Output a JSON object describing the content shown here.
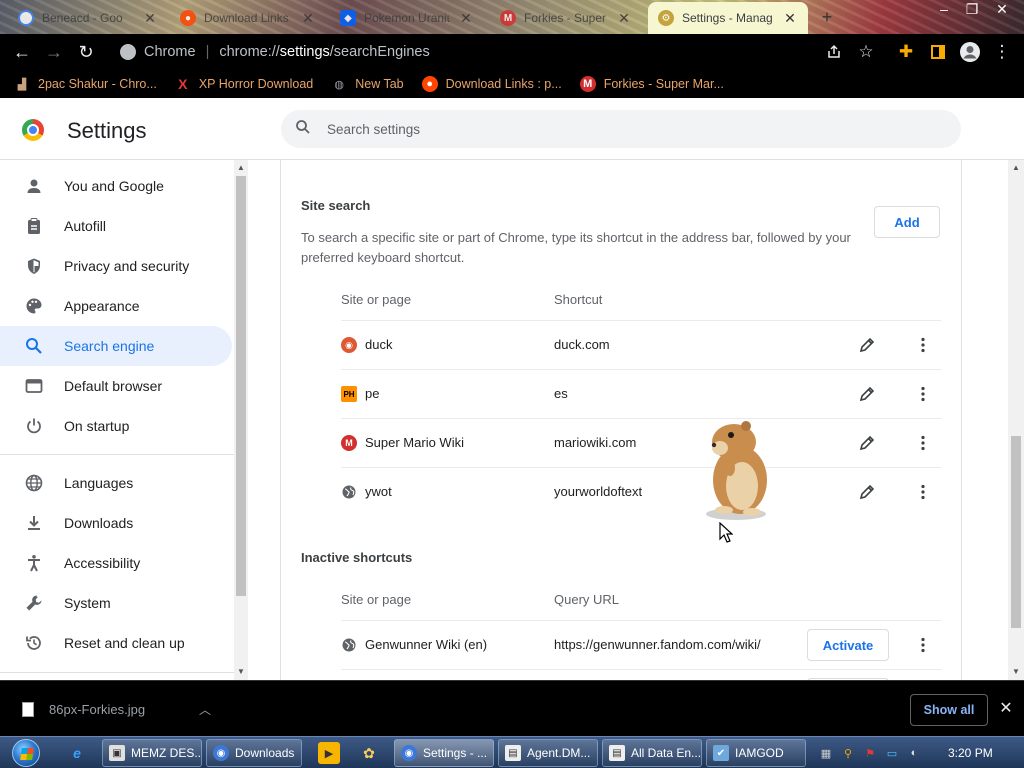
{
  "tabs": [
    {
      "title": "Beneacd - Goo",
      "favicon": "google-icon",
      "active": false
    },
    {
      "title": "Download Links",
      "favicon": "reddit-icon",
      "active": false
    },
    {
      "title": "Pokemon Uranium",
      "favicon": "dropbox-icon",
      "active": false
    },
    {
      "title": "Forkies - Super",
      "favicon": "mario-icon",
      "active": false
    },
    {
      "title": "Settings - Manag",
      "favicon": "settings-icon",
      "active": true
    }
  ],
  "new_tab_symbol": "+",
  "address_bar": {
    "site_label": "Chrome",
    "url_prefix": "chrome://",
    "url_strong": "settings",
    "url_suffix": "/searchEngines"
  },
  "bookmarks": [
    {
      "label": "2pac Shakur - Chro...",
      "icon": "bookmark-user-icon"
    },
    {
      "label": "XP Horror Download",
      "icon": "x-icon"
    },
    {
      "label": "New Tab",
      "icon": "globe-icon"
    },
    {
      "label": "Download Links : p...",
      "icon": "reddit-icon"
    },
    {
      "label": "Forkies - Super Mar...",
      "icon": "mario-icon"
    }
  ],
  "header": {
    "title": "Settings",
    "search_placeholder": "Search settings"
  },
  "sidebar": {
    "items": [
      {
        "label": "You and Google",
        "icon": "person-icon",
        "selected": false
      },
      {
        "label": "Autofill",
        "icon": "clipboard-icon",
        "selected": false
      },
      {
        "label": "Privacy and security",
        "icon": "shield-icon",
        "selected": false
      },
      {
        "label": "Appearance",
        "icon": "palette-icon",
        "selected": false
      },
      {
        "label": "Search engine",
        "icon": "search-icon",
        "selected": true
      },
      {
        "label": "Default browser",
        "icon": "browser-icon",
        "selected": false
      },
      {
        "label": "On startup",
        "icon": "power-icon",
        "selected": false
      },
      {
        "label": "Languages",
        "icon": "globe-icon",
        "selected": false
      },
      {
        "label": "Downloads",
        "icon": "download-icon",
        "selected": false
      },
      {
        "label": "Accessibility",
        "icon": "accessibility-icon",
        "selected": false
      },
      {
        "label": "System",
        "icon": "wrench-icon",
        "selected": false
      },
      {
        "label": "Reset and clean up",
        "icon": "history-icon",
        "selected": false
      }
    ]
  },
  "site_search": {
    "title": "Site search",
    "description": "To search a specific site or part of Chrome, type its shortcut in the address bar, followed by your preferred keyboard shortcut.",
    "add_label": "Add",
    "col_site": "Site or page",
    "col_shortcut": "Shortcut",
    "rows": [
      {
        "name": "duck",
        "shortcut": "duck.com",
        "favicon": "duckduckgo-icon"
      },
      {
        "name": "pe",
        "shortcut": "es",
        "favicon": "ph-icon"
      },
      {
        "name": "Super Mario Wiki",
        "shortcut": "mariowiki.com",
        "favicon": "mario-icon"
      },
      {
        "name": "ywot",
        "shortcut": "yourworldoftext",
        "favicon": "globe-icon"
      }
    ]
  },
  "inactive_shortcuts": {
    "title": "Inactive shortcuts",
    "col_site": "Site or page",
    "col_url": "Query URL",
    "rows": [
      {
        "name": "Genwunner Wiki (en)",
        "url": "https://genwunner.fandom.com/wiki/",
        "action": "Activate",
        "favicon": "globe-icon"
      }
    ]
  },
  "download_bar": {
    "file_name": "86px-Forkies.jpg",
    "show_all_label": "Show all"
  },
  "taskbar": {
    "tasks": [
      {
        "label": "MEMZ DES...",
        "icon": "window-icon"
      },
      {
        "label": "Downloads",
        "icon": "chrome-icon"
      },
      {
        "label": "Settings - ...",
        "icon": "chrome-icon",
        "active": true
      },
      {
        "label": "Agent.DM...",
        "icon": "app-icon"
      },
      {
        "label": "All Data En...",
        "icon": "app-icon"
      },
      {
        "label": "IAMGOD",
        "icon": "app-icon"
      }
    ],
    "clock": "3:20 PM"
  },
  "colors": {
    "accent": "#1a73e8",
    "selected_bg": "#e8f0fe",
    "bookmark_text": "#e8a56b"
  }
}
